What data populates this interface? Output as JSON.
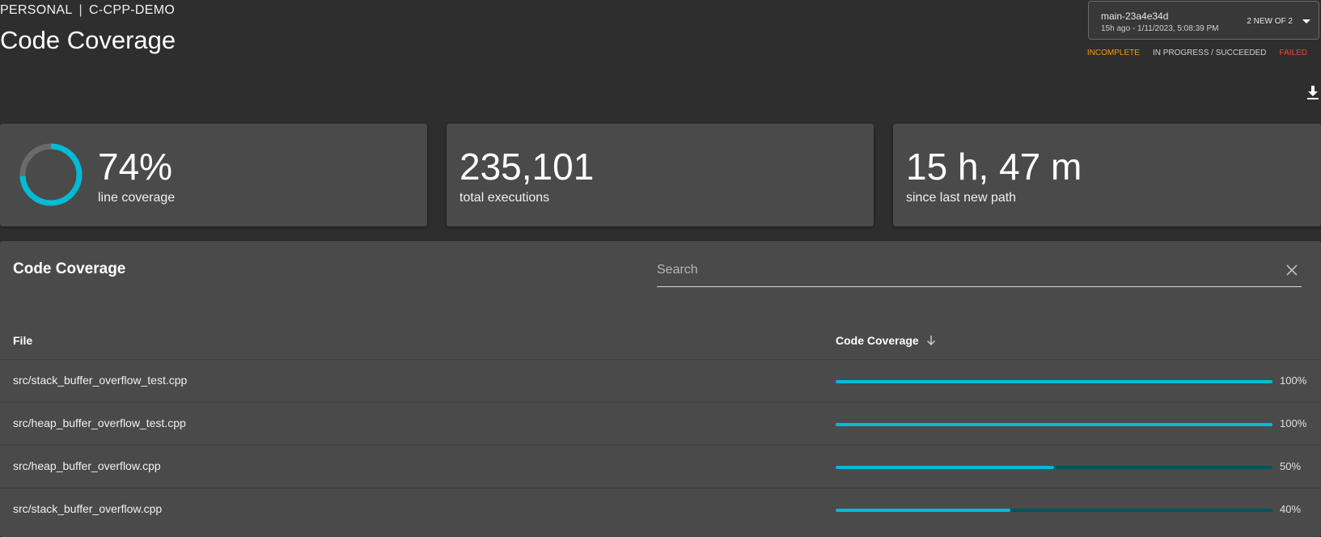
{
  "header": {
    "breadcrumb_project": "PERSONAL",
    "breadcrumb_separator": "|",
    "breadcrumb_repo": "C-CPP-DEMO",
    "title": "Code Coverage"
  },
  "run_selector": {
    "run_name": "main-23a4e34d",
    "run_time": "15h ago - 1/11/2023, 5:08:39 PM",
    "run_count": "2 NEW OF 2"
  },
  "status_legend": {
    "incomplete": "INCOMPLETE",
    "in_progress": "IN PROGRESS / SUCCEEDED",
    "failed": "FAILED"
  },
  "colors": {
    "accent": "#00bcd4",
    "track": "#00545e",
    "incomplete": "#ff9800",
    "failed": "#f44336",
    "card": "#4a4a4a",
    "background": "#2e2e2e"
  },
  "stats": {
    "coverage_value": "74%",
    "coverage_fraction": 0.74,
    "coverage_label": "line coverage",
    "executions_value": "235,101",
    "executions_label": "total executions",
    "last_path_value": "15 h, 47 m",
    "last_path_label": "since last new path"
  },
  "table": {
    "title": "Code Coverage",
    "search_placeholder": "Search",
    "col_file": "File",
    "col_coverage": "Code Coverage",
    "sort_icon": "arrow-down-icon",
    "rows": [
      {
        "file": "src/stack_buffer_overflow_test.cpp",
        "coverage": 1.0,
        "pct": "100%"
      },
      {
        "file": "src/heap_buffer_overflow_test.cpp",
        "coverage": 1.0,
        "pct": "100%"
      },
      {
        "file": "src/heap_buffer_overflow.cpp",
        "coverage": 0.5,
        "pct": "50%"
      },
      {
        "file": "src/stack_buffer_overflow.cpp",
        "coverage": 0.4,
        "pct": "40%"
      }
    ]
  },
  "icons": {
    "download": "download-icon",
    "clear": "close-icon",
    "caret": "caret-down-icon"
  }
}
